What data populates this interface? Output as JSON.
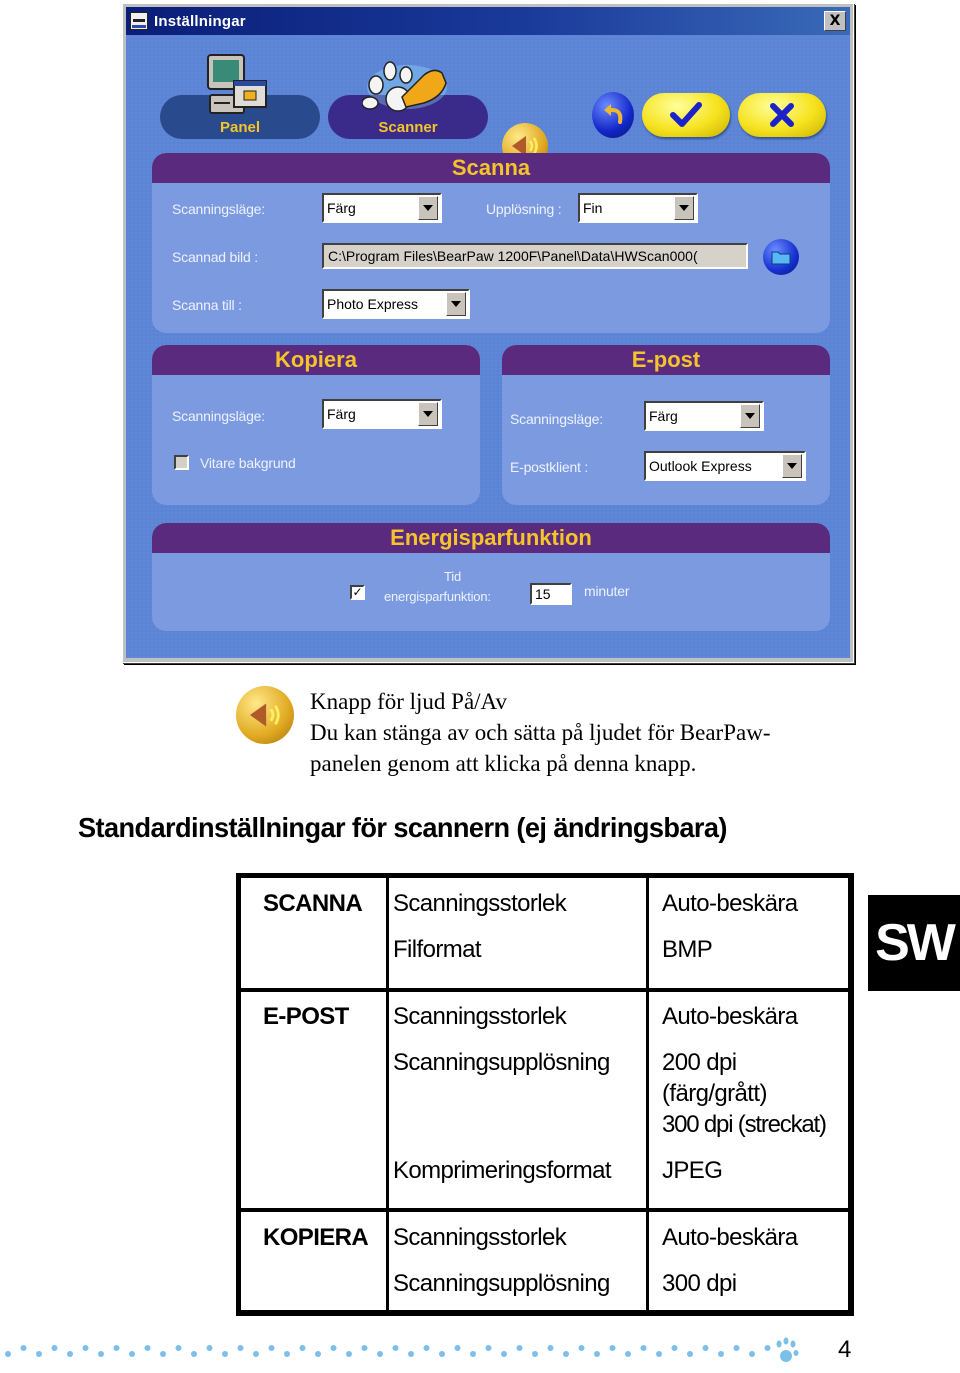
{
  "window": {
    "title": "Inställningar",
    "close_label": "X",
    "nav_tabs": [
      {
        "label": "Panel",
        "icon": "computer-icon"
      },
      {
        "label": "Scanner",
        "icon": "paw-hand-icon",
        "active": true
      }
    ],
    "toolbar": {
      "sound_icon": "speaker-icon",
      "undo_icon": "undo-arrow-icon",
      "ok_icon": "checkmark-icon",
      "cancel_icon": "x-icon"
    },
    "scanna": {
      "title": "Scanna",
      "scan_mode_label": "Scanningsläge:",
      "scan_mode_value": "Färg",
      "resolution_label": "Upplösning :",
      "resolution_value": "Fin",
      "scanned_image_label": "Scannad bild :",
      "scanned_image_path": "C:\\Program Files\\BearPaw 1200F\\Panel\\Data\\HWScan000(",
      "scan_to_label": "Scanna till :",
      "scan_to_value": "Photo Express"
    },
    "kopiera": {
      "title": "Kopiera",
      "scan_mode_label": "Scanningsläge:",
      "scan_mode_value": "Färg",
      "whiter_background_label": "Vitare bakgrund",
      "whiter_background_checked": false
    },
    "epost": {
      "title": "E-post",
      "scan_mode_label": "Scanningsläge:",
      "scan_mode_value": "Färg",
      "client_label": "E-postklient :",
      "client_value": "Outlook Express"
    },
    "energy": {
      "title": "Energisparfunktion",
      "enabled": true,
      "time_label_line1": "Tid",
      "time_label_line2": "energisparfunktion:",
      "minutes_value": "15",
      "minutes_unit": "minuter"
    }
  },
  "sound_note": {
    "line1": "Knapp för ljud På/Av",
    "line2": "Du kan stänga av och sätta på ljudet för BearPaw-",
    "line3": "panelen genom att klicka på denna knapp."
  },
  "defaults": {
    "heading": "Standardinställningar för scannern (ej ändringsbara)",
    "rows": [
      {
        "category": "SCANNA",
        "settings": [
          "Scanningsstorlek",
          "Filformat"
        ],
        "values": [
          "Auto-beskära",
          "BMP"
        ]
      },
      {
        "category": "E-POST",
        "settings": [
          "Scanningsstorlek",
          "Scanningsupplösning",
          "Komprimeringsformat"
        ],
        "values": [
          "Auto-beskära",
          "200 dpi",
          "(färg/grått)",
          "300 dpi (streckat)",
          "JPEG"
        ]
      },
      {
        "category": "KOPIERA",
        "settings": [
          "Scanningsstorlek",
          "Scanningsupplösning"
        ],
        "values": [
          "Auto-beskära",
          "300 dpi"
        ]
      }
    ]
  },
  "language_tab": "SW",
  "page_number": "4",
  "colors": {
    "window_bg": "#5b84d6",
    "section_bg": "#7b9ae0",
    "section_header": "#5a2a7e",
    "header_text": "#f5c42a",
    "footer_dots": "#7cc0ea"
  }
}
